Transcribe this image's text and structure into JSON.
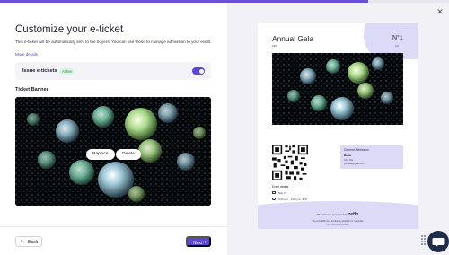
{
  "progress": {
    "fraction": 0.82
  },
  "left": {
    "title": "Customize your e-ticket",
    "description": "This e-ticket will be automatically sent to the buyers. You can use these to manage admission to your event.",
    "more_details": "More details",
    "issue": {
      "label": "Issue e-tickets",
      "status": "Active",
      "enabled": true
    },
    "banner_label": "Ticket Banner",
    "replace_label": "Replace",
    "delete_label": "Delete"
  },
  "footer": {
    "back_label": "Back",
    "next_label": "Next"
  },
  "preview": {
    "title": "Annual Gala",
    "org": "Zeffy",
    "number": "N°1",
    "number_sub": "1/4",
    "admission": {
      "title": "General Admission",
      "buyer_label": "Buyer",
      "buyer_name": "John Doe",
      "buyer_email": "john.doe@gmail.com"
    },
    "event_details_label": "Event details",
    "date": "May 27",
    "time": "6:00 p.m. - 8:00 p.m. EDT",
    "sponsor_prefix": "This ticket is sponsored by",
    "sponsor_brand": "zeffy",
    "tagline": "The only 100% free fundraising platform for nonprofits",
    "fineprint": "Zeffy · powered by generosity"
  },
  "colors": {
    "accent": "#5b46d6",
    "active_badge": "#ddf4e3",
    "ticket_tint": "#dcdaf6",
    "chat": "#1f2d4a"
  },
  "icons": {
    "close": "close-icon",
    "back": "chevron-left-icon",
    "next": "chevron-right-icon",
    "chat": "chat-bubble-icon",
    "grip": "drag-handle-icon"
  }
}
